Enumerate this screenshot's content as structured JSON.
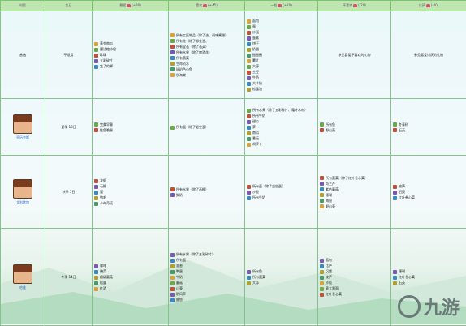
{
  "header": {
    "col_name": "村民",
    "col_birthday": "生日",
    "col_love": "最爱",
    "col_love_pts": "(+80)",
    "col_like": "喜欢",
    "col_like_pts": "(+45)",
    "col_neutral": "一般",
    "col_neutral_pts": "(+20)",
    "col_dislike": "不喜欢",
    "col_dislike_pts": "(-20)",
    "col_hate": "讨厌",
    "col_hate_pts": "(-40)"
  },
  "rows": [
    {
      "name": "普遍",
      "birthday": "不适用",
      "love": [
        "黄金南瓜",
        "魔法糖冰棍",
        "珍珠",
        "五彩碎片",
        "兔子的脚"
      ],
      "like": [
        "所有工匠物品（除了油、调味酱醋）",
        "所有花（除了郁金香、",
        "所有宝石（除了石英）",
        "所有水果（除了啤酒花）",
        "所有蔬菜",
        "生命药水",
        "琥珀色小鱼",
        "秋海棠"
      ],
      "neutral": [
        "面包",
        "蛋",
        "炒蛋",
        "蛋糕",
        "饼干",
        "奶酪",
        "甜甜圈",
        "薯片",
        "大蒜",
        "土豆",
        "牛奶",
        "大羊奶",
        "松露油"
      ],
      "dislike": [
        "参见喜爱不喜欢的礼物"
      ],
      "hate": [
        "参见喜爱讨厌的礼物"
      ]
    },
    {
      "name": "亚历克斯",
      "birthday": "夏季 13日",
      "love": [
        "完美早餐",
        "鲑鱼晚餐"
      ],
      "like": [
        "所有蛋（除了虚空蛋）"
      ],
      "neutral": [
        "所有水果（除了五彩碎片、霜叶木材）",
        "所有牛奶",
        "甜瓜",
        "萝卜",
        "南瓜",
        "番茄",
        "胡萝卜"
      ],
      "dislike": [
        "所有鱼",
        "野山葵"
      ],
      "hate": [
        "冬青树",
        "石英"
      ]
    },
    {
      "name": "艾利欧特",
      "birthday": "秋季 5日",
      "love": [
        "龙虾",
        "石榴",
        "蟹",
        "鸭毛",
        "卡布奇诺"
      ],
      "like": [
        "所有水果（除了石榴）",
        "鲜奶"
      ],
      "neutral": [
        "所有蛋（除了虚空蛋）",
        "沙拉",
        "所有牛奶"
      ],
      "dislike": [
        "所有蔬菜（除了红叶卷心菜）",
        "荷兰芹",
        "紫色蘑菇",
        "珊瑚",
        "海胆",
        "野山葵"
      ],
      "hate": [
        "披萨",
        "石英",
        "红叶卷心菜"
      ]
    },
    {
      "name": "哈维",
      "birthday": "冬季 14日",
      "love": [
        "咖啡",
        "腌菜",
        "超级蘑菇",
        "松露",
        "红酒"
      ],
      "like": [
        "所有水果（除了五彩碎片）",
        "所有蛋",
        "韭葱",
        "鸭蛋",
        "牛奶",
        "蘑菇",
        "山葵",
        "防风草",
        "鲑鱼"
      ],
      "neutral": [
        "所有鱼",
        "所有蔬菜",
        "大蒜"
      ],
      "dislike": [
        "面包",
        "比萨",
        "汉堡",
        "披萨",
        "炒饭",
        "意大利面",
        "红叶卷心菜"
      ],
      "hate": [
        "珊瑚",
        "红叶卷心菜",
        "石英"
      ]
    }
  ],
  "watermark": "九游"
}
